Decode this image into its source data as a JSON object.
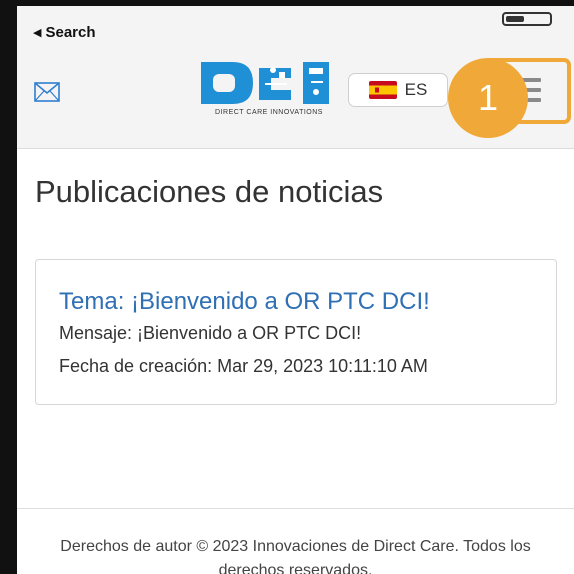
{
  "status_bar": {
    "back_label": "Search"
  },
  "header": {
    "logo_caption": "DIRECT CARE INNOVATIONS",
    "language_label": "ES",
    "badge_number": "1"
  },
  "main": {
    "title": "Publicaciones de noticias",
    "news": [
      {
        "topic": "Tema: ¡Bienvenido a OR PTC DCI!",
        "message": "Mensaje: ¡Bienvenido a OR PTC DCI!",
        "created": "Fecha de creación: Mar 29, 2023 10:11:10 AM"
      }
    ]
  },
  "footer": {
    "line1": "Derechos de autor © 2023 Innovaciones de Direct Care. Todos los",
    "line2": "derechos reservados."
  },
  "colors": {
    "accent_orange": "#f0a938",
    "link_blue": "#2f6fb4",
    "logo_blue": "#1f8fd6",
    "header_bg": "#f4f4f4"
  },
  "icons": [
    "mail-icon",
    "spain-flag-icon",
    "hamburger-menu-icon",
    "back-triangle-icon"
  ]
}
